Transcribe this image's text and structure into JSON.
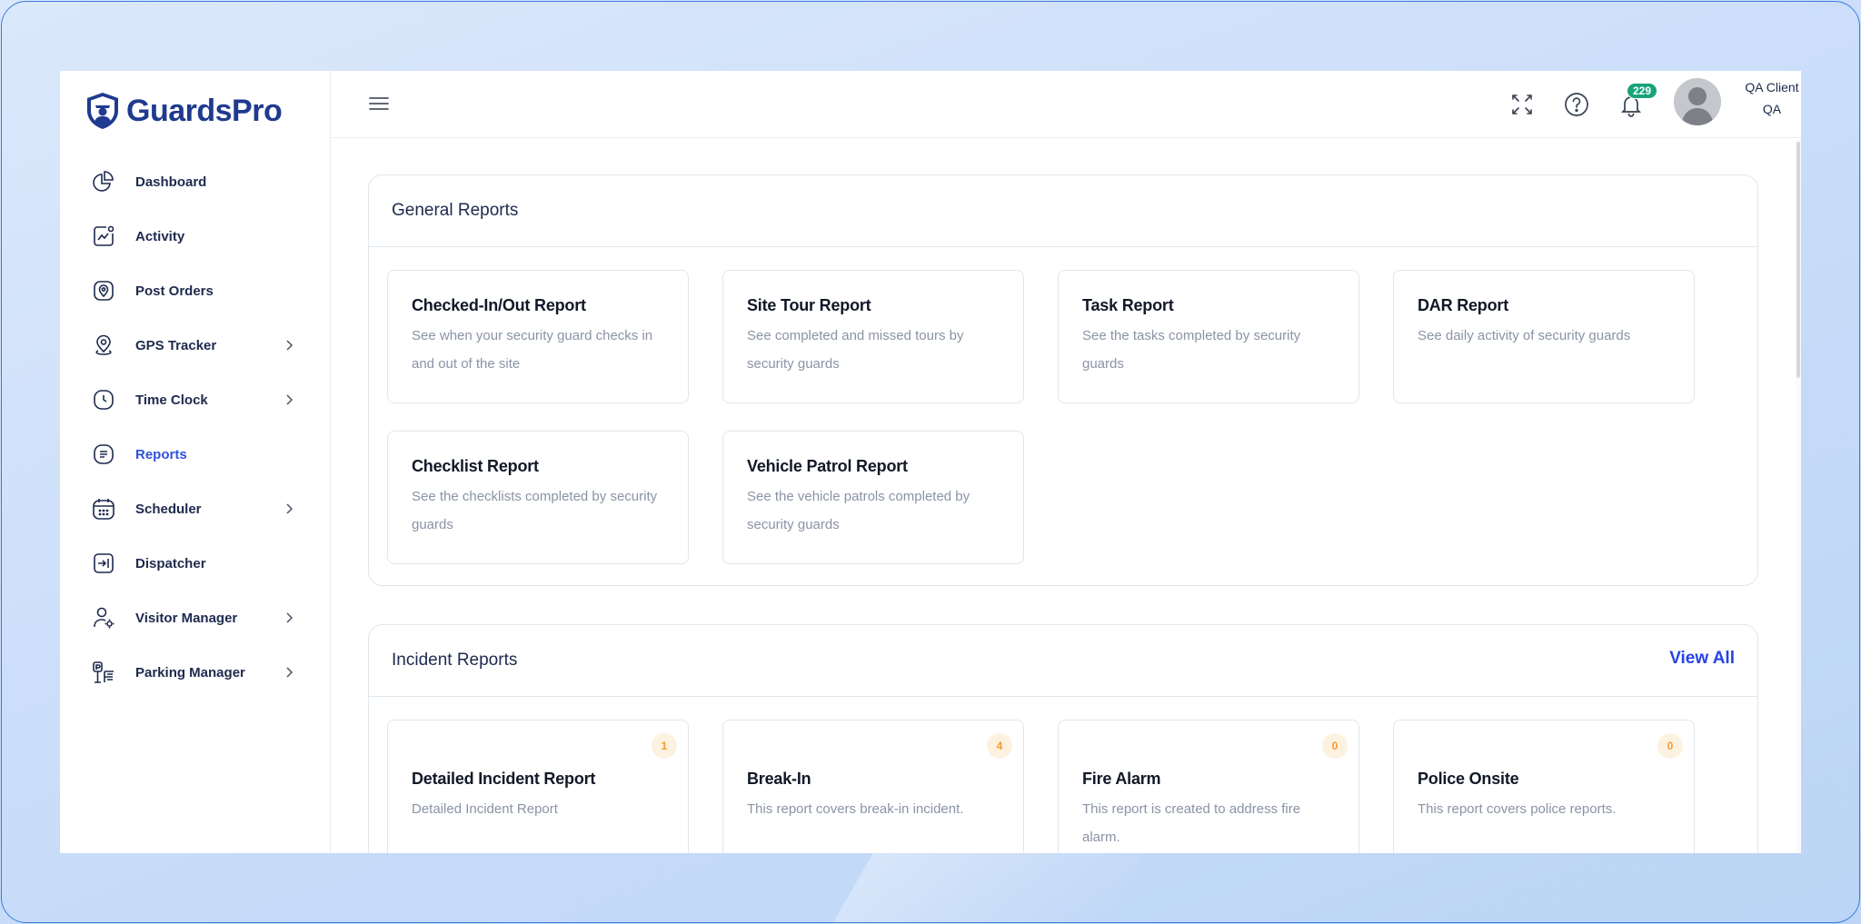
{
  "brand": {
    "name": "GuardsPro"
  },
  "sidebar": {
    "items": [
      {
        "label": "Dashboard",
        "icon": "pie-chart-icon",
        "has_submenu": false,
        "active": false
      },
      {
        "label": "Activity",
        "icon": "activity-chart-icon",
        "has_submenu": false,
        "active": false
      },
      {
        "label": "Post Orders",
        "icon": "location-pin-icon",
        "has_submenu": false,
        "active": false
      },
      {
        "label": "GPS Tracker",
        "icon": "gps-pin-icon",
        "has_submenu": true,
        "active": false
      },
      {
        "label": "Time Clock",
        "icon": "clock-icon",
        "has_submenu": true,
        "active": false
      },
      {
        "label": "Reports",
        "icon": "document-icon",
        "has_submenu": false,
        "active": true
      },
      {
        "label": "Scheduler",
        "icon": "calendar-icon",
        "has_submenu": true,
        "active": false
      },
      {
        "label": "Dispatcher",
        "icon": "dispatch-icon",
        "has_submenu": false,
        "active": false
      },
      {
        "label": "Visitor Manager",
        "icon": "visitor-icon",
        "has_submenu": true,
        "active": false
      },
      {
        "label": "Parking Manager",
        "icon": "parking-icon",
        "has_submenu": true,
        "active": false
      }
    ],
    "active_color": "#2f52e0"
  },
  "topbar": {
    "notifications_count": "229",
    "user_name": "QA Client",
    "user_role": "QA",
    "icons": [
      "menu-icon",
      "fullscreen-icon",
      "help-icon",
      "bell-icon",
      "avatar",
      "chevron-down-icon"
    ]
  },
  "general_reports": {
    "title": "General Reports",
    "cards": [
      {
        "title": "Checked-In/Out Report",
        "description": "See when your security guard checks in and out of the site"
      },
      {
        "title": "Site Tour Report",
        "description": "See completed and missed tours by security guards"
      },
      {
        "title": "Task Report",
        "description": "See the tasks completed by security guards"
      },
      {
        "title": "DAR Report",
        "description": "See daily activity of security guards"
      },
      {
        "title": "Checklist Report",
        "description": "See the checklists completed by security guards"
      },
      {
        "title": "Vehicle Patrol Report",
        "description": "See the vehicle patrols completed by security guards"
      }
    ]
  },
  "incident_reports": {
    "title": "Incident Reports",
    "view_all_label": "View All",
    "cards": [
      {
        "title": "Detailed Incident Report",
        "description": "Detailed Incident Report",
        "count": "1"
      },
      {
        "title": "Break-In",
        "description": "This report covers break-in incident.",
        "count": "4"
      },
      {
        "title": "Fire Alarm",
        "description": "This report is created to address fire alarm.",
        "count": "0"
      },
      {
        "title": "Police Onsite",
        "description": "This report covers police reports.",
        "count": "0"
      }
    ]
  },
  "colors": {
    "brand_navy": "#1f3a8f",
    "link_blue": "#2643e5",
    "badge_green": "#1aa37a",
    "count_orange": "#f29a2e"
  }
}
